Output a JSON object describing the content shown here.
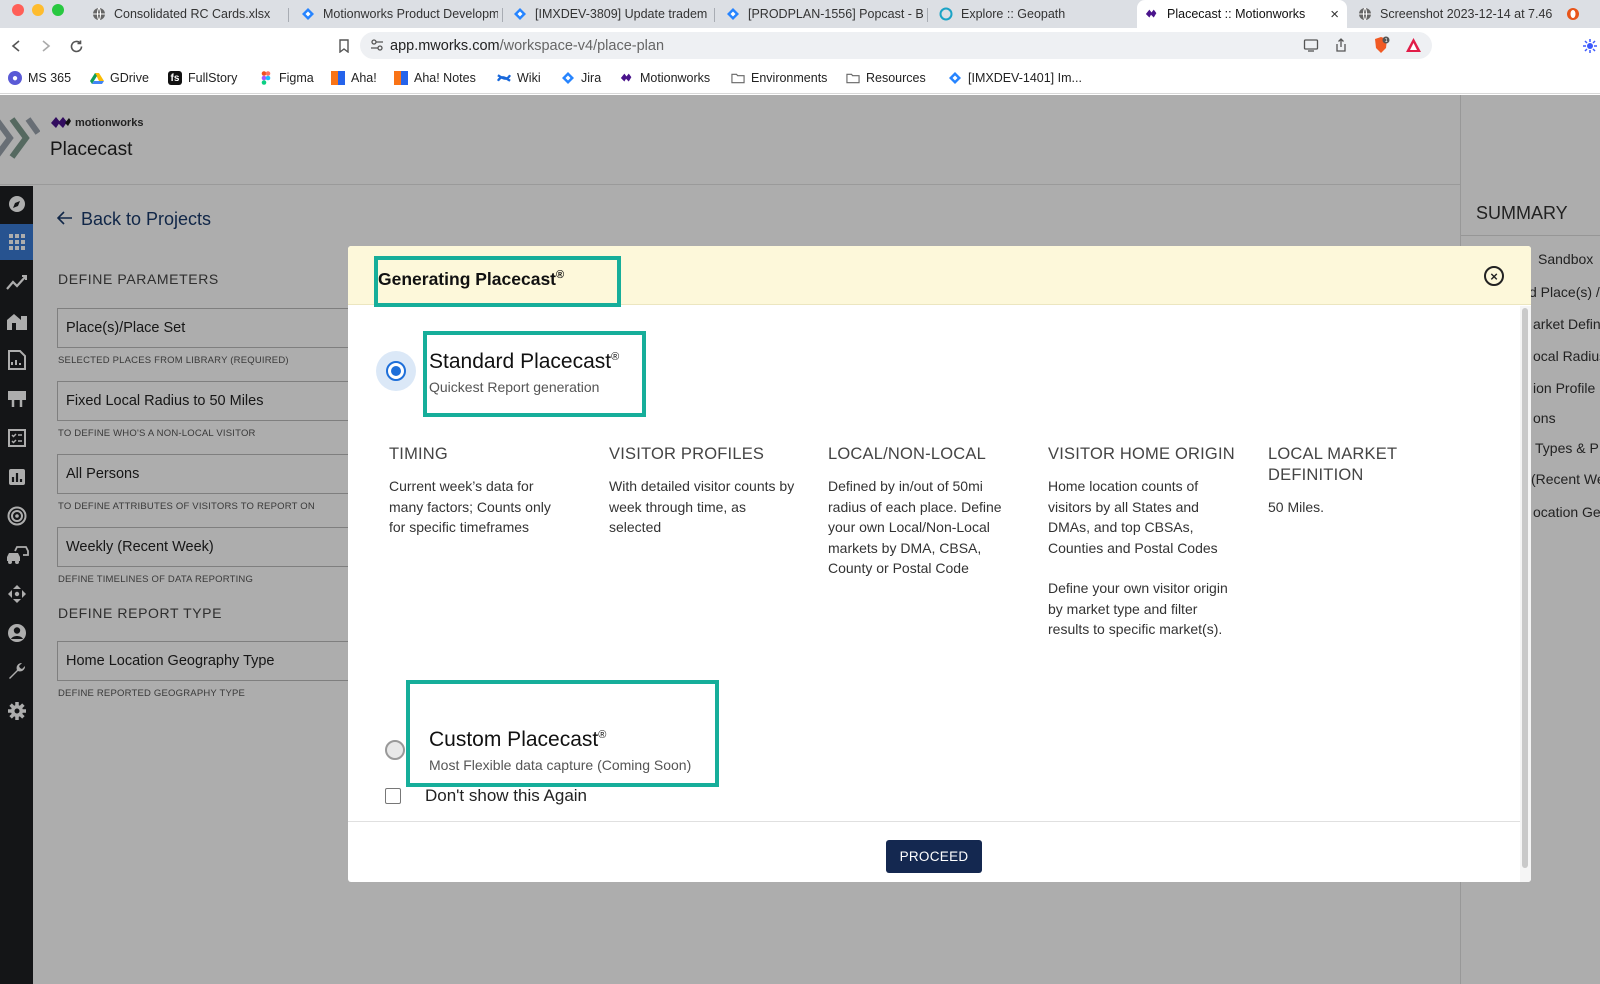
{
  "browser": {
    "tabs": [
      {
        "label": "Consolidated RC Cards.xlsx",
        "icon": "globe-icon"
      },
      {
        "label": "Motionworks Product Developm",
        "icon": "jira-icon"
      },
      {
        "label": "[IMXDEV-3809] Update tradem",
        "icon": "jira-icon"
      },
      {
        "label": "[PRODPLAN-1556] Popcast - B",
        "icon": "jira-icon"
      },
      {
        "label": "Explore :: Geopath",
        "icon": "geopath-icon"
      },
      {
        "label": "Placecast :: Motionworks",
        "icon": "motionworks-icon"
      },
      {
        "label": "Screenshot 2023-12-14 at 7.46",
        "icon": "globe-icon"
      }
    ],
    "active_tab_close": "×",
    "url_host": "app.mworks.com",
    "url_path": "/workspace-v4/place-plan",
    "bookmarks": [
      {
        "label": "MS 365",
        "color": "#5a5ad6"
      },
      {
        "label": "GDrive",
        "color": "#f2b600"
      },
      {
        "label": "FullStory",
        "color": "#111111"
      },
      {
        "label": "Figma",
        "color": "#f24e1e"
      },
      {
        "label": "Aha!",
        "color": "#2563eb"
      },
      {
        "label": "Aha! Notes",
        "color": "#2563eb"
      },
      {
        "label": "Wiki",
        "color": "#1868db"
      },
      {
        "label": "Jira",
        "color": "#1868db"
      },
      {
        "label": "Motionworks",
        "color": "#6a1b9a"
      },
      {
        "label": "Environments",
        "color": "#888888"
      },
      {
        "label": "Resources",
        "color": "#888888"
      },
      {
        "label": "[IMXDEV-1401] Im...",
        "color": "#1868db"
      }
    ]
  },
  "app": {
    "brand": "motionworks",
    "name": "Placecast",
    "back_label": "Back to Projects",
    "define_parameters": "DEFINE PARAMETERS",
    "fields": [
      {
        "value": "Place(s)/Place Set",
        "hint": "SELECTED PLACES FROM LIBRARY (REQUIRED)"
      },
      {
        "value": "Fixed Local Radius to 50 Miles",
        "hint": "TO DEFINE WHO'S A NON-LOCAL VISITOR"
      },
      {
        "value": "All Persons",
        "hint": "TO DEFINE ATTRIBUTES OF VISITORS TO REPORT ON"
      },
      {
        "value": "Weekly (Recent Week)",
        "hint": "DEFINE TIMELINES OF DATA REPORTING"
      }
    ],
    "define_report_type": "DEFINE REPORT TYPE",
    "report_field": {
      "value": "Home Location Geography Type",
      "hint": "DEFINE REPORTED GEOGRAPHY TYPE"
    },
    "summary": {
      "title": "SUMMARY",
      "items": [
        "Sandbox",
        "d Place(s) /",
        "arket Defin",
        "ocal Radius",
        "ion Profile",
        "ons",
        "Types & P",
        "(Recent We",
        "ocation Ge"
      ]
    }
  },
  "modal": {
    "title": "Generating Placecast",
    "reg_mark": "®",
    "close_symbol": "×",
    "standard": {
      "title": "Standard Placecast",
      "subtitle": "Quickest Report generation"
    },
    "columns": [
      {
        "heading": "TIMING",
        "body": "Current week’s data for many factors; Counts only for specific timeframes",
        "body2": ""
      },
      {
        "heading": "VISITOR PROFILES",
        "body": "With detailed visitor counts by week through time, as selected",
        "body2": ""
      },
      {
        "heading": "LOCAL/NON-LOCAL",
        "body": "Defined by in/out of 50mi radius of each place. Define your own Local/Non-Local markets by DMA, CBSA, County or Postal Code",
        "body2": ""
      },
      {
        "heading": "VISITOR HOME ORIGIN",
        "body": "Home location counts of visitors by all States and DMAs, and top CBSAs, Counties and Postal Codes",
        "body2": "Define your own visitor origin by market type and filter results to specific market(s)."
      },
      {
        "heading": "LOCAL MARKET DEFINITION",
        "body": "50 Miles.",
        "body2": ""
      }
    ],
    "custom": {
      "title": "Custom Placecast",
      "subtitle": "Most Flexible data capture (Coming Soon)"
    },
    "dont_show": "Don't show this Again",
    "proceed": "PROCEED"
  },
  "colors": {
    "highlight": "#16ae9a",
    "primary_button": "#142850",
    "radio_selected": "#1e6fd9",
    "modal_header": "#fdf8da"
  }
}
